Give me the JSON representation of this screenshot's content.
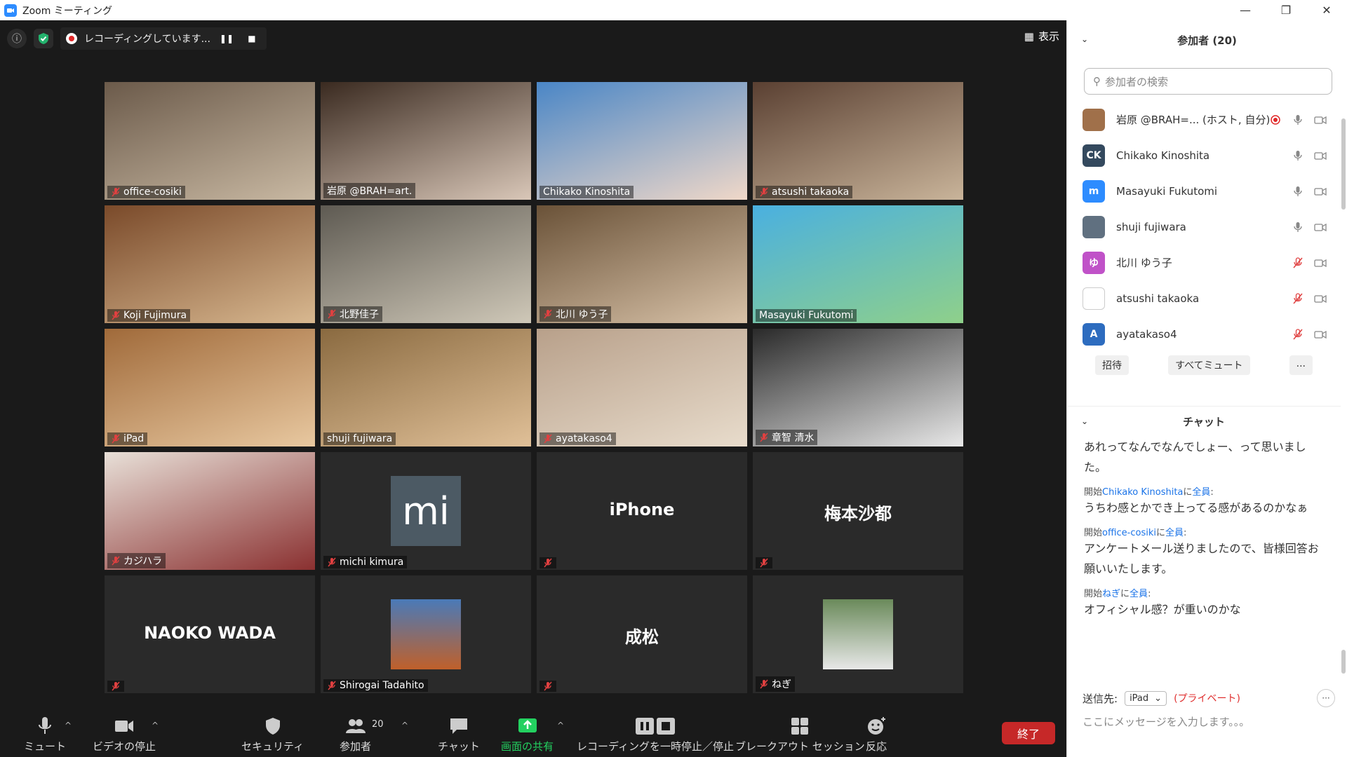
{
  "window": {
    "title": "Zoom ミーティング"
  },
  "topbar": {
    "recording_label": "レコーディングしています...",
    "view_label": "表示"
  },
  "tiles": [
    {
      "name": "office-cosiki",
      "muted": true,
      "kind": "video",
      "bg": [
        "#6b5a4a",
        "#c9b9a3"
      ]
    },
    {
      "name": "岩原 @BRAH=art.",
      "muted": false,
      "kind": "video",
      "active": true,
      "bg": [
        "#3a2a20",
        "#d9c7b8"
      ]
    },
    {
      "name": "Chikako Kinoshita",
      "muted": false,
      "kind": "video",
      "bg": [
        "#4a86c6",
        "#f0d8c8"
      ]
    },
    {
      "name": "atsushi takaoka",
      "muted": true,
      "kind": "video",
      "bg": [
        "#5a4032",
        "#c9b49a"
      ]
    },
    {
      "name": "Koji Fujimura",
      "muted": true,
      "kind": "video",
      "bg": [
        "#7a4a2a",
        "#d8b890"
      ]
    },
    {
      "name": "北野佳子",
      "muted": true,
      "kind": "video",
      "bg": [
        "#5e5a52",
        "#cfc8b8"
      ]
    },
    {
      "name": "北川 ゆう子",
      "muted": true,
      "kind": "video",
      "bg": [
        "#6a5238",
        "#d8c2a8"
      ]
    },
    {
      "name": "Masayuki Fukutomi",
      "muted": false,
      "kind": "video",
      "bg": [
        "#4ab0e0",
        "#8fd08a"
      ]
    },
    {
      "name": "iPad",
      "muted": true,
      "kind": "video",
      "bg": [
        "#a06a3a",
        "#e8c8a0"
      ]
    },
    {
      "name": "shuji fujiwara",
      "muted": false,
      "kind": "video",
      "bg": [
        "#8a6a40",
        "#e0c098"
      ]
    },
    {
      "name": "ayatakaso4",
      "muted": true,
      "kind": "video",
      "bg": [
        "#b8a08a",
        "#e8dccc"
      ]
    },
    {
      "name": "章智 清水",
      "muted": true,
      "kind": "video",
      "bg": [
        "#2a2a2a",
        "#e8e8e8"
      ]
    },
    {
      "name": "カジハラ",
      "muted": true,
      "kind": "video",
      "bg": [
        "#e8e0d8",
        "#8a3030"
      ]
    },
    {
      "name": "michi kimura",
      "muted": true,
      "kind": "avatar",
      "avatar_text": "mi"
    },
    {
      "name": "",
      "muted": true,
      "kind": "text",
      "big_text": "iPhone"
    },
    {
      "name": "",
      "muted": true,
      "kind": "text",
      "big_text": "梅本沙都"
    },
    {
      "name": "",
      "muted": true,
      "kind": "text",
      "big_text": "NAOKO WADA"
    },
    {
      "name": "Shirogai Tadahito",
      "muted": true,
      "kind": "thumb",
      "bg": [
        "#4a7ab8",
        "#c0602a"
      ]
    },
    {
      "name": "",
      "muted": true,
      "kind": "text",
      "big_text": "成松"
    },
    {
      "name": "ねぎ",
      "muted": true,
      "kind": "thumb",
      "bg": [
        "#6a8a5a",
        "#e8e8e8"
      ]
    }
  ],
  "toolbar": {
    "mute": "ミュート",
    "video": "ビデオの停止",
    "security": "セキュリティ",
    "participants": "参加者",
    "participants_count": "20",
    "chat": "チャット",
    "share": "画面の共有",
    "record": "レコーディングを一時停止／停止",
    "breakout": "ブレークアウト セッション",
    "reactions": "反応",
    "end": "終了"
  },
  "participants_panel": {
    "title": "参加者 (20)",
    "search_placeholder": "参加者の検索",
    "invite": "招待",
    "mute_all": "すべてミュート",
    "more": "...",
    "items": [
      {
        "name": "岩原 @BRAH=... (ホスト, 自分)",
        "avatar": "",
        "color": "#a0704a",
        "mic": "on",
        "rec": true
      },
      {
        "name": "Chikako Kinoshita",
        "avatar": "CK",
        "color": "#34495e",
        "mic": "on"
      },
      {
        "name": "Masayuki Fukutomi",
        "avatar": "m",
        "color": "#2d8cff",
        "mic": "on"
      },
      {
        "name": "shuji fujiwara",
        "avatar": "",
        "color": "#607080",
        "mic": "on"
      },
      {
        "name": "北川 ゆう子",
        "avatar": "ゆ",
        "color": "#c052c8",
        "mic": "off"
      },
      {
        "name": "atsushi takaoka",
        "avatar": "",
        "color": "#ffffff",
        "mic": "off"
      },
      {
        "name": "ayatakaso4",
        "avatar": "A",
        "color": "#2d6cbf",
        "mic": "off"
      }
    ]
  },
  "chat_panel": {
    "title": "チャット",
    "partial_text": "あれってなんでなんでしょー、って思いました。",
    "messages": [
      {
        "prefix": "開始",
        "who": "Chikako Kinoshita",
        "mid": "に",
        "to": "全員",
        "suffix": ":",
        "text": "うちわ感とかでき上ってる感があるのかなぁ"
      },
      {
        "prefix": "開始",
        "who": "office-cosiki",
        "mid": "に",
        "to": "全員",
        "suffix": ":",
        "text": "アンケートメール送りましたので、皆様回答お願いいたします。"
      },
      {
        "prefix": "開始",
        "who": "ねぎ",
        "mid": "に",
        "to": "全員",
        "suffix": ":",
        "text": "オフィシャル感？が重いのかな"
      }
    ],
    "send_to_label": "送信先:",
    "send_to_value": "iPad",
    "private_label": "(プライベート)",
    "input_placeholder": "ここにメッセージを入力します。。。"
  }
}
